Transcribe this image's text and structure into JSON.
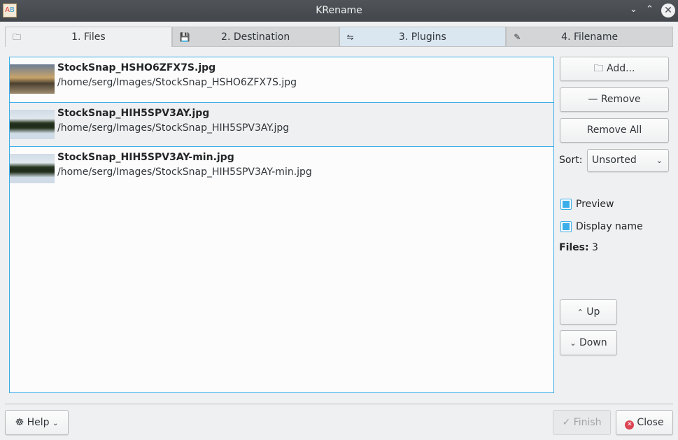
{
  "window": {
    "title": "KRename",
    "app_icon_a": "A",
    "app_icon_b": "B"
  },
  "tabs": [
    {
      "label": "1. Files",
      "icon": "folder-icon"
    },
    {
      "label": "2. Destination",
      "icon": "save-icon"
    },
    {
      "label": "3. Plugins",
      "icon": "sliders-icon"
    },
    {
      "label": "4. Filename",
      "icon": "pencil-icon"
    }
  ],
  "files": [
    {
      "name": "StockSnap_HSHO6ZFX7S.jpg",
      "path": "/home/serg/Images/StockSnap_HSHO6ZFX7S.jpg"
    },
    {
      "name": "StockSnap_HIH5SPV3AY.jpg",
      "path": "/home/serg/Images/StockSnap_HIH5SPV3AY.jpg"
    },
    {
      "name": "StockSnap_HIH5SPV3AY-min.jpg",
      "path": "/home/serg/Images/StockSnap_HIH5SPV3AY-min.jpg"
    }
  ],
  "side": {
    "add": "Add...",
    "remove": "Remove",
    "remove_all": "Remove All",
    "sort_label": "Sort:",
    "sort_value": "Unsorted",
    "preview": "Preview",
    "display_name": "Display name",
    "files_label": "Files:",
    "files_count": "3",
    "up": "Up",
    "down": "Down"
  },
  "footer": {
    "help": "Help",
    "finish": "Finish",
    "close": "Close"
  },
  "colors": {
    "accent": "#3daee9",
    "titlebar": "#474b50",
    "close": "#da4453"
  }
}
